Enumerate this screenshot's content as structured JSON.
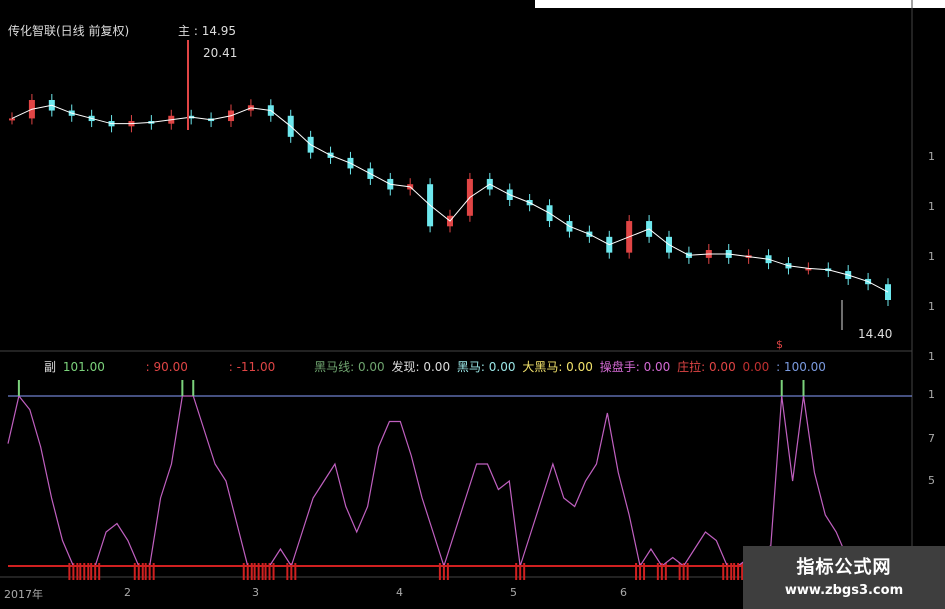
{
  "header": {
    "title": "传化智联(日线 前复权)",
    "main_label": "主",
    "main_value": "14.95"
  },
  "annotations": {
    "high": "20.41",
    "low": "14.40",
    "signal": "$"
  },
  "indicator": {
    "label": "副",
    "values": [
      {
        "text": "101.00",
        "color": "#7cd37c"
      },
      {
        "text": ": 90.00",
        "color": "#e04545"
      },
      {
        "text": ": -11.00",
        "color": "#e04545"
      },
      {
        "text": "黑马线: 0.00",
        "color": "#6fa56f"
      },
      {
        "text": "发现: 0.00",
        "color": "#dddddd"
      },
      {
        "text": "黑马: 0.00",
        "color": "#9be7e7"
      },
      {
        "text": "大黑马: 0.00",
        "color": "#f3e36c"
      },
      {
        "text": "操盘手: 0.00",
        "color": "#d36ad3"
      },
      {
        "text": "庄拉: 0.00",
        "color": "#e04545"
      },
      {
        "text": "0.00",
        "color": "#c03030"
      },
      {
        "text": ": 100.00",
        "color": "#7b9be0"
      }
    ]
  },
  "x_axis": [
    "2017年",
    "2",
    "3",
    "4",
    "5",
    "6"
  ],
  "y_axis_main": [
    "1",
    "1",
    "1",
    "1",
    "1"
  ],
  "y_axis_sub": [
    "1",
    "7",
    "5"
  ],
  "watermark": {
    "line1": "指标公式网",
    "line2": "www.zbgs3.com"
  },
  "colors": {
    "up": "#e04545",
    "down": "#6ee8ee",
    "ma": "#ffffff",
    "osc": "#c060c0",
    "base": "#d02020",
    "ref": "#8aa0ff",
    "signal": "#7cd37c"
  },
  "chart_data": {
    "type": "candlestick",
    "close": [
      14.95,
      15.3,
      15.1,
      15.0,
      14.9,
      14.8,
      14.9,
      14.85,
      15.0,
      14.95,
      14.9,
      15.1,
      15.2,
      15.0,
      14.6,
      14.3,
      14.2,
      14.0,
      13.8,
      13.6,
      13.7,
      12.9,
      13.1,
      13.8,
      13.6,
      13.4,
      13.3,
      13.0,
      12.8,
      12.7,
      12.4,
      13.0,
      12.7,
      12.4,
      12.3,
      12.45,
      12.3,
      12.35,
      12.2,
      12.1,
      12.1,
      12.05,
      11.9,
      11.8,
      11.5
    ],
    "osc": [
      72,
      100,
      92,
      70,
      40,
      15,
      0,
      0,
      0,
      20,
      25,
      15,
      0,
      0,
      40,
      60,
      100,
      100,
      80,
      60,
      50,
      25,
      0,
      0,
      0,
      10,
      0,
      20,
      40,
      50,
      60,
      35,
      20,
      35,
      70,
      85,
      85,
      65,
      40,
      20,
      0,
      20,
      40,
      60,
      60,
      45,
      50,
      0,
      20,
      40,
      60,
      40,
      35,
      50,
      60,
      90,
      55,
      30,
      0,
      10,
      0,
      5,
      0,
      10,
      20,
      15,
      0,
      0,
      5,
      8,
      12,
      100,
      50,
      100,
      55,
      30,
      20,
      5,
      0
    ],
    "ylim_sub": [
      0,
      120
    ]
  }
}
